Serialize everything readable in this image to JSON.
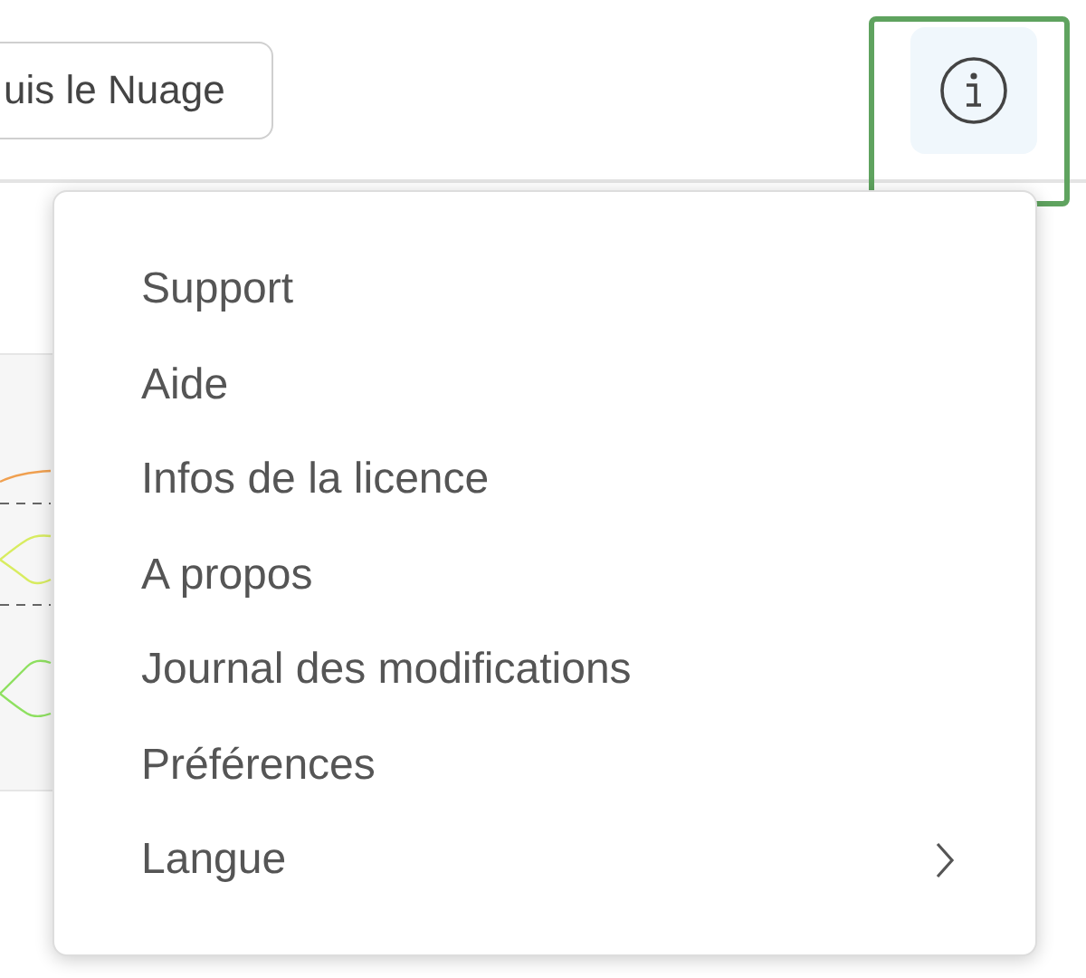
{
  "toolbar": {
    "cloud_button": "uis le Nuage",
    "info_button_highlighted": true
  },
  "menu": {
    "items": [
      {
        "label": "Support",
        "submenu": false
      },
      {
        "label": "Aide",
        "submenu": false
      },
      {
        "label": "Infos de la licence",
        "submenu": false
      },
      {
        "label": "A propos",
        "submenu": false
      },
      {
        "label": "Journal des modifications",
        "submenu": false
      },
      {
        "label": "Préférences",
        "submenu": false
      },
      {
        "label": "Langue",
        "submenu": true
      }
    ]
  }
}
